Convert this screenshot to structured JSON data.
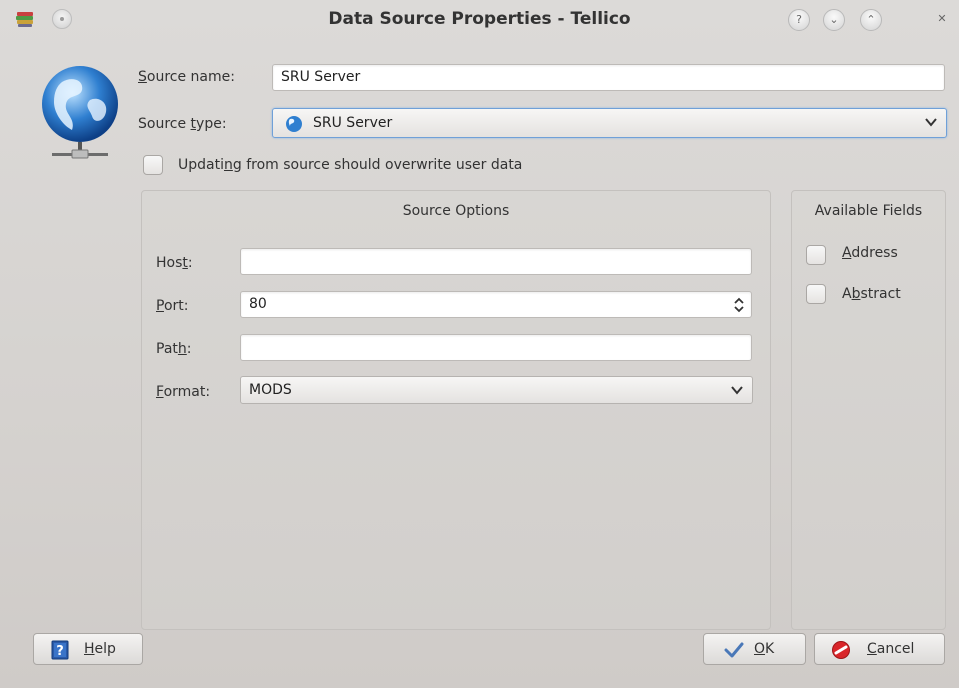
{
  "window": {
    "title": "Data Source Properties - Tellico"
  },
  "titlebar_buttons": {
    "help": "?",
    "minimize": "⌄",
    "maximize": "⌃",
    "close": "✕"
  },
  "form": {
    "source_name_label_pre": "",
    "source_name_label_u": "S",
    "source_name_label_post": "ource name:",
    "source_name_value": "SRU Server",
    "source_type_label_pre": "Source ",
    "source_type_label_u": "t",
    "source_type_label_post": "ype:",
    "source_type_value": "SRU Server",
    "overwrite_label_pre": "Updati",
    "overwrite_label_u": "n",
    "overwrite_label_post": "g from source should overwrite user data"
  },
  "source_options": {
    "title": "Source Options",
    "host_label_pre": "Hos",
    "host_label_u": "t",
    "host_label_post": ":",
    "host_value": "",
    "port_label_pre": "",
    "port_label_u": "P",
    "port_label_post": "ort:",
    "port_value": "80",
    "path_label_pre": "Pat",
    "path_label_u": "h",
    "path_label_post": ":",
    "path_value": "",
    "format_label_pre": "",
    "format_label_u": "F",
    "format_label_post": "ormat:",
    "format_value": "MODS"
  },
  "available_fields": {
    "title": "Available Fields",
    "field1_u": "A",
    "field1_post": "ddress",
    "field2_pre": "A",
    "field2_u": "b",
    "field2_post": "stract"
  },
  "buttons": {
    "help_u": "H",
    "help_post": "elp",
    "ok_u": "O",
    "ok_post": "K",
    "cancel_u": "C",
    "cancel_post": "ancel"
  },
  "colors": {
    "window_bg": "#d5d2cf",
    "focus_border": "#6fa0d8",
    "cancel_red": "#d9262a",
    "ok_blue": "#4a78b8"
  }
}
